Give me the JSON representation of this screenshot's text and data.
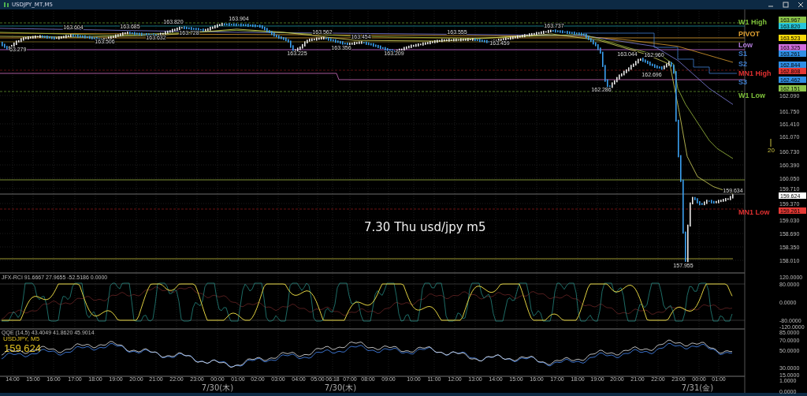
{
  "window": {
    "title": "USDJPY_MT,M5"
  },
  "main_chart": {
    "annotation": "7.30 Thu usd/jpy m5",
    "period_marker": "20",
    "price_labels": [
      "63.279",
      "163.604",
      "163.506",
      "163.685",
      "163.632",
      "163.820",
      "163.728",
      "163.904",
      "163.225",
      "163.562",
      "163.356",
      "163.454",
      "163.209",
      "163.555",
      "163.459",
      "163.737",
      "162.286",
      "163.044",
      "162.960",
      "162.696",
      "159.634",
      "157.955"
    ],
    "level_labels": [
      {
        "text": "W1 High",
        "color": "#7ec13a"
      },
      {
        "text": "PIVOT",
        "color": "#e0a030"
      },
      {
        "text": "Low",
        "color": "#b07ad8"
      },
      {
        "text": "S1",
        "color": "#3f7fd0"
      },
      {
        "text": "S2",
        "color": "#3f7fd0"
      },
      {
        "text": "MN1 High",
        "color": "#e03030"
      },
      {
        "text": "S3",
        "color": "#3f7fd0"
      },
      {
        "text": "W1 Low",
        "color": "#7ec13a"
      },
      {
        "text": "MN1 Low",
        "color": "#e03030"
      }
    ],
    "price_tags": [
      {
        "text": "163.967",
        "color": "#8bc34a"
      },
      {
        "text": "163.820",
        "color": "#26c6da"
      },
      {
        "text": "163.523",
        "color": "#f5d90a"
      },
      {
        "text": "163.325",
        "color": "#d26ee0"
      },
      {
        "text": "163.261",
        "color": "#2f8fe6"
      },
      {
        "text": "162.844",
        "color": "#2f8fe6"
      },
      {
        "text": "162.808",
        "color": "#e53935"
      },
      {
        "text": "162.462",
        "color": "#2f8fe6"
      },
      {
        "text": "162.151",
        "color": "#8bc34a"
      },
      {
        "text": "159.624",
        "color": "#ffffff"
      },
      {
        "text": "159.261",
        "color": "#e53935"
      }
    ],
    "axis_labels": [
      "162.090",
      "161.750",
      "161.410",
      "161.070",
      "160.730",
      "160.390",
      "160.050",
      "159.710",
      "159.370",
      "159.030",
      "158.690",
      "158.350",
      "158.010"
    ]
  },
  "rci_panel": {
    "legend": "JFX-RCI 91.6667 27.9655 -52.5186 0.0000",
    "axis_labels": [
      "120.0000",
      "80.0000",
      "0.0000",
      "-80.0000",
      "-120.0000"
    ]
  },
  "qqe_panel": {
    "legend": "QQE (14,5) 43.4049 41.8620 45.9014",
    "symbol": "USDJPY, M5",
    "price": "159.624",
    "axis_labels": [
      "85.0000",
      "70.0000",
      "50.0000",
      "30.0000",
      "15.0000",
      "1.0000",
      "0.0000"
    ]
  },
  "time_axis": {
    "times": [
      "14:00",
      "15:00",
      "16:00",
      "17:00",
      "18:00",
      "19:00",
      "20:00",
      "21:00",
      "22:00",
      "23:00",
      "00:00",
      "01:00",
      "02:00",
      "03:00",
      "04:00",
      "05:00",
      "06:18",
      "07:00",
      "08:00",
      "09:00",
      "10:00",
      "11:00",
      "12:00",
      "13:00",
      "14:00",
      "15:00",
      "16:00",
      "17:00",
      "18:00",
      "19:00",
      "20:00",
      "21:00",
      "22:00",
      "23:00",
      "00:00",
      "01:00"
    ],
    "dates": [
      "7/30(木)",
      "7/30(木)",
      "7/31(金)"
    ]
  }
}
